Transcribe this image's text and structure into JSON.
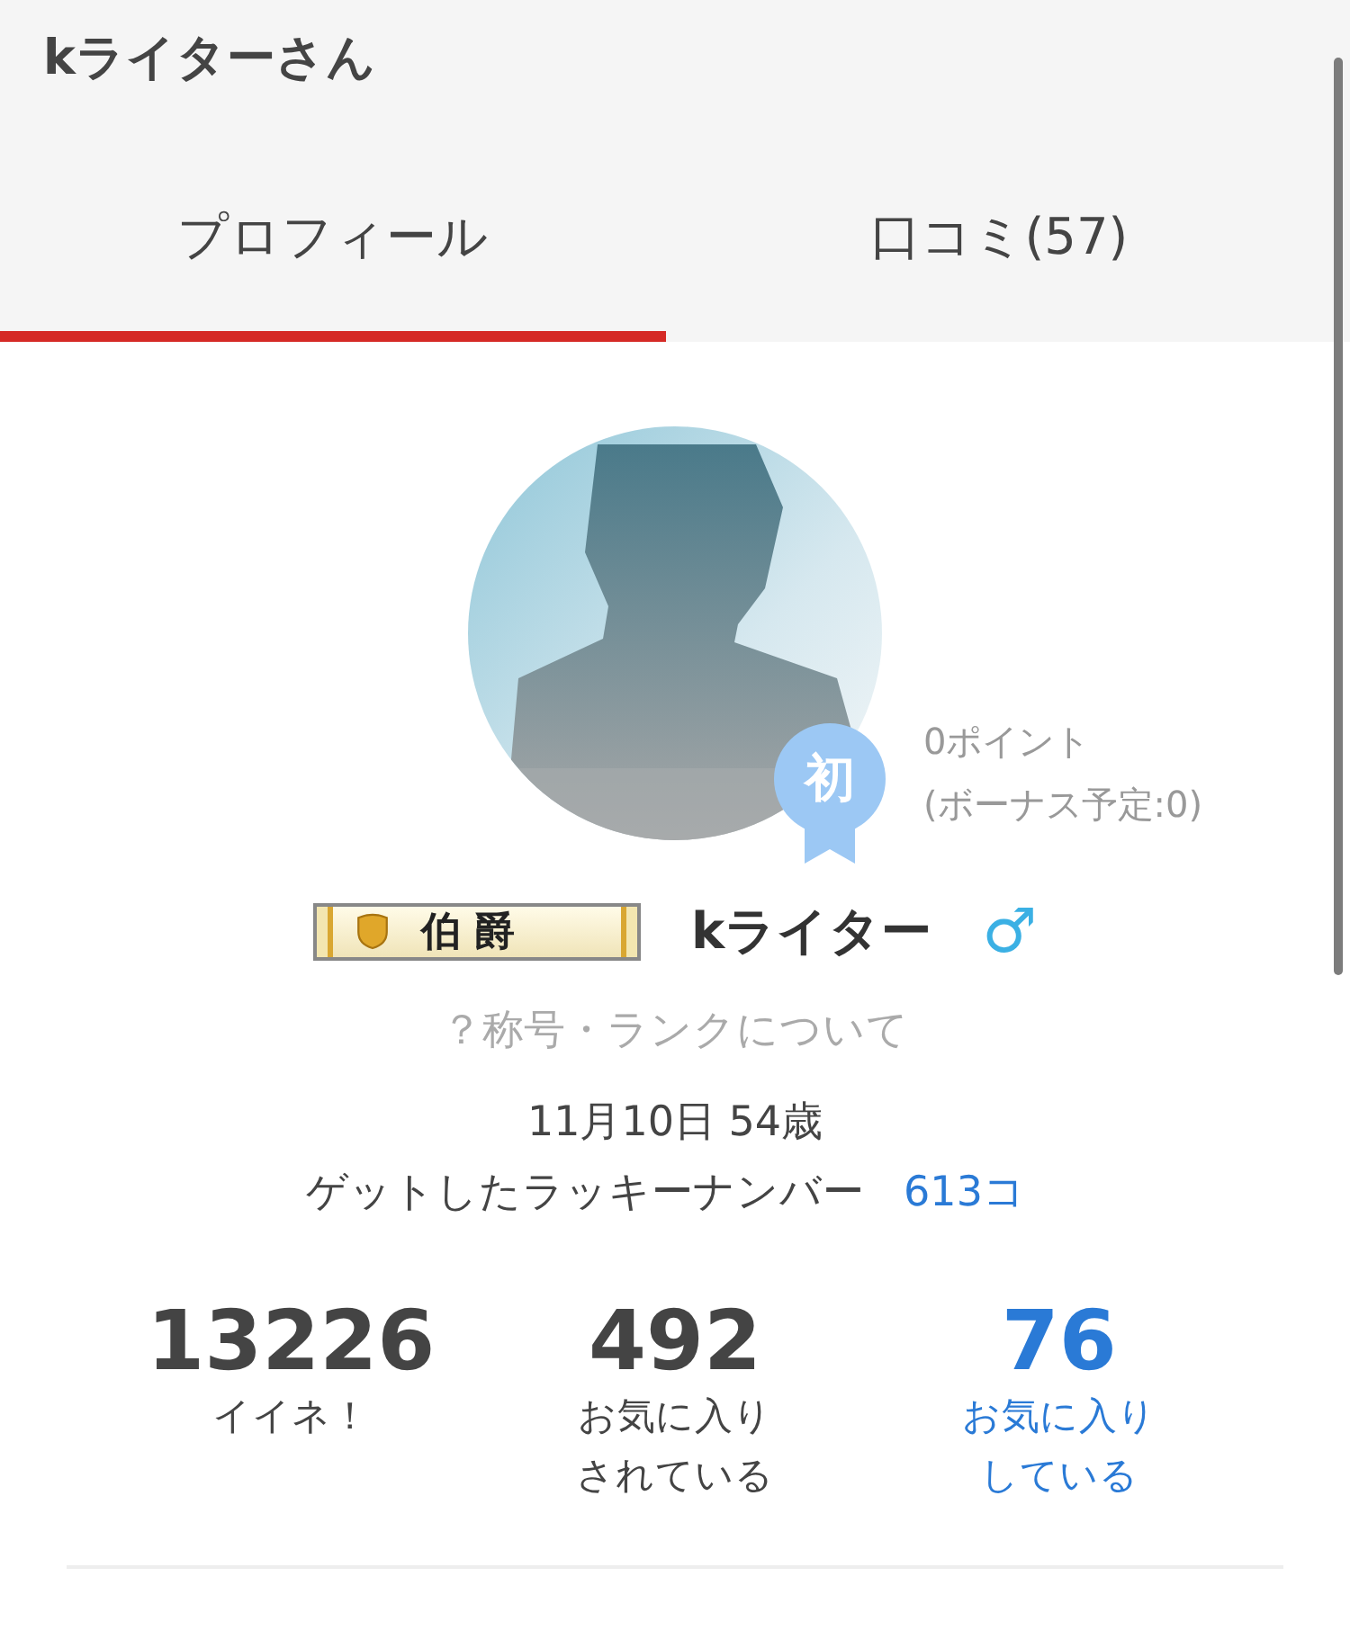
{
  "header": {
    "title": "kライターさん"
  },
  "tabs": [
    {
      "label": "プロフィール",
      "selected": true
    },
    {
      "label": "口コミ(57)",
      "selected": false
    }
  ],
  "profile": {
    "beginner_badge": "初",
    "points": "0ポイント",
    "bonus": "(ボーナス予定:0)",
    "rank": "伯爵",
    "name": "kライター",
    "gender": "♂",
    "rank_link": "？称号・ランクについて",
    "birthday": "11月10日 54歳",
    "lucky_label": "ゲットしたラッキーナンバー",
    "lucky_count": "613コ"
  },
  "stats": [
    {
      "value": "13226",
      "label": [
        "イイネ！"
      ],
      "link": false
    },
    {
      "value": "492",
      "label": [
        "お気に入り",
        "されている"
      ],
      "link": false
    },
    {
      "value": "76",
      "label": [
        "お気に入り",
        "している"
      ],
      "link": true
    }
  ]
}
